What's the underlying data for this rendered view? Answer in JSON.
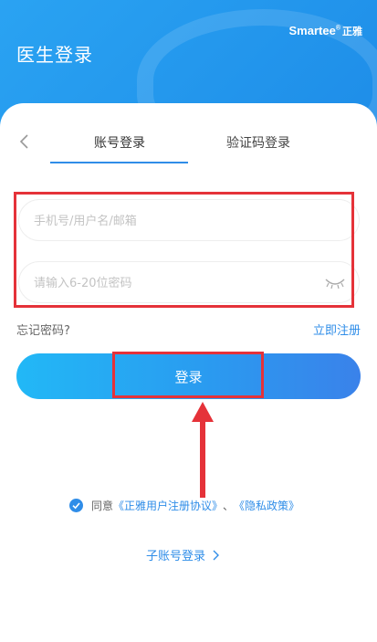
{
  "header": {
    "title": "医生登录",
    "brand_name": "Smartee",
    "brand_mark": "®",
    "brand_cn": "正雅",
    "bg_color": "#1f8fe9"
  },
  "tabs": [
    {
      "label": "账号登录",
      "active": true
    },
    {
      "label": "验证码登录",
      "active": false
    }
  ],
  "form": {
    "username_placeholder": "手机号/用户名/邮箱",
    "username_value": "",
    "password_placeholder": "请输入6-20位密码",
    "password_value": ""
  },
  "links": {
    "forgot_password": "忘记密码?",
    "register_now": "立即注册"
  },
  "login_button": "登录",
  "agreement": {
    "prefix": "同意",
    "user_agreement": "《正雅用户注册协议》",
    "separator": "、",
    "privacy_policy": "《隐私政策》",
    "checked": true
  },
  "sub_account": "子账号登录",
  "colors": {
    "accent": "#2f8de8",
    "annotation": "#e53239"
  },
  "icons": [
    "back-arrow-icon",
    "eye-closed-icon",
    "check-circle-icon",
    "chevron-right-icon"
  ]
}
